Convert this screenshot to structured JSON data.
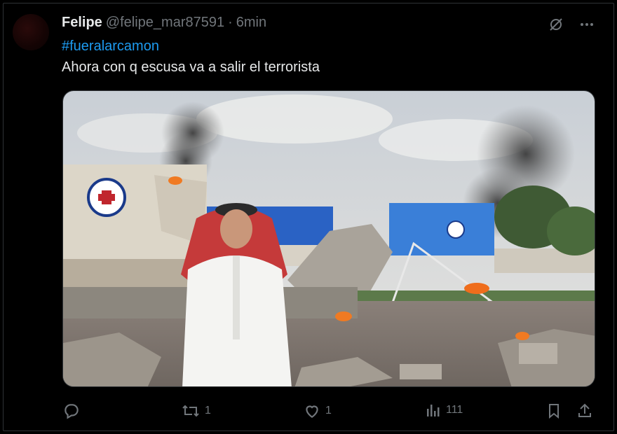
{
  "tweet": {
    "display_name": "Felipe",
    "handle": "@felipe_mar87591",
    "separator": "·",
    "time": "6min",
    "hashtag": "#fueralarcamon",
    "text": "Ahora con q escusa va a salir el terrorista"
  },
  "media": {
    "description_icon": "image"
  },
  "actions": {
    "reply_count": "",
    "retweet_count": "1",
    "like_count": "1",
    "views_count": "111"
  },
  "colors": {
    "background": "#000000",
    "text": "#e7e9ea",
    "muted": "#71767b",
    "accent": "#1d9bf0",
    "border": "#2f3336"
  },
  "icons": {
    "grok": "grok-icon",
    "more": "more-icon",
    "reply": "reply-icon",
    "retweet": "retweet-icon",
    "like": "like-icon",
    "views": "views-icon",
    "bookmark": "bookmark-icon",
    "share": "share-icon"
  }
}
